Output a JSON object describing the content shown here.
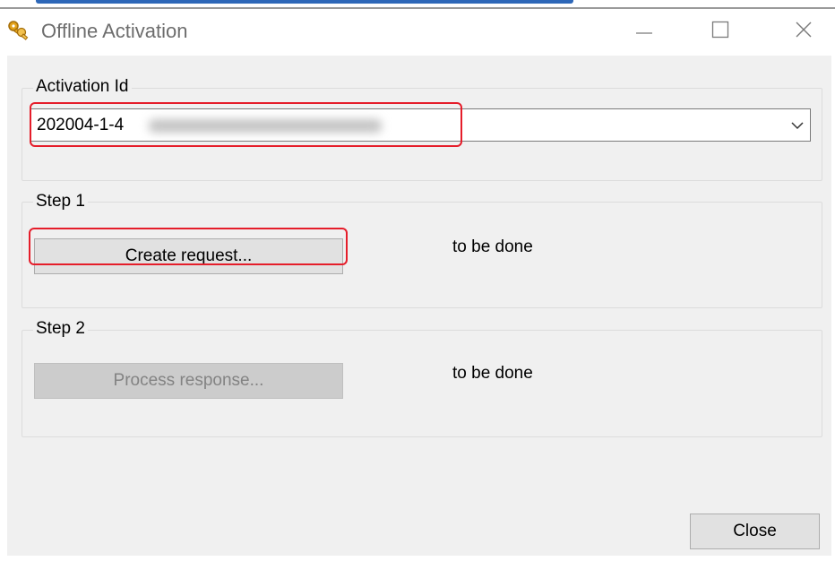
{
  "window": {
    "title": "Offline Activation",
    "app_icon": "keys-icon"
  },
  "title_bar": {
    "minimize_icon": "minimize-icon",
    "maximize_icon": "maximize-icon",
    "close_icon": "close-icon"
  },
  "activation": {
    "group_label": "Activation Id",
    "value": "202004-1-4",
    "value_obscured": true,
    "dropdown_icon": "chevron-down-icon"
  },
  "step1": {
    "label": "Step 1",
    "button_label": "Create request...",
    "status": "to be done"
  },
  "step2": {
    "label": "Step 2",
    "button_label": "Process response...",
    "button_enabled": false,
    "status": "to be done"
  },
  "footer": {
    "close_label": "Close"
  },
  "highlights": [
    "activation-id-combo",
    "create-request-button"
  ],
  "colors": {
    "highlight": "#e51d2a",
    "title_accent": "#2d67b8",
    "dialog_background": "#f0f0f0"
  }
}
